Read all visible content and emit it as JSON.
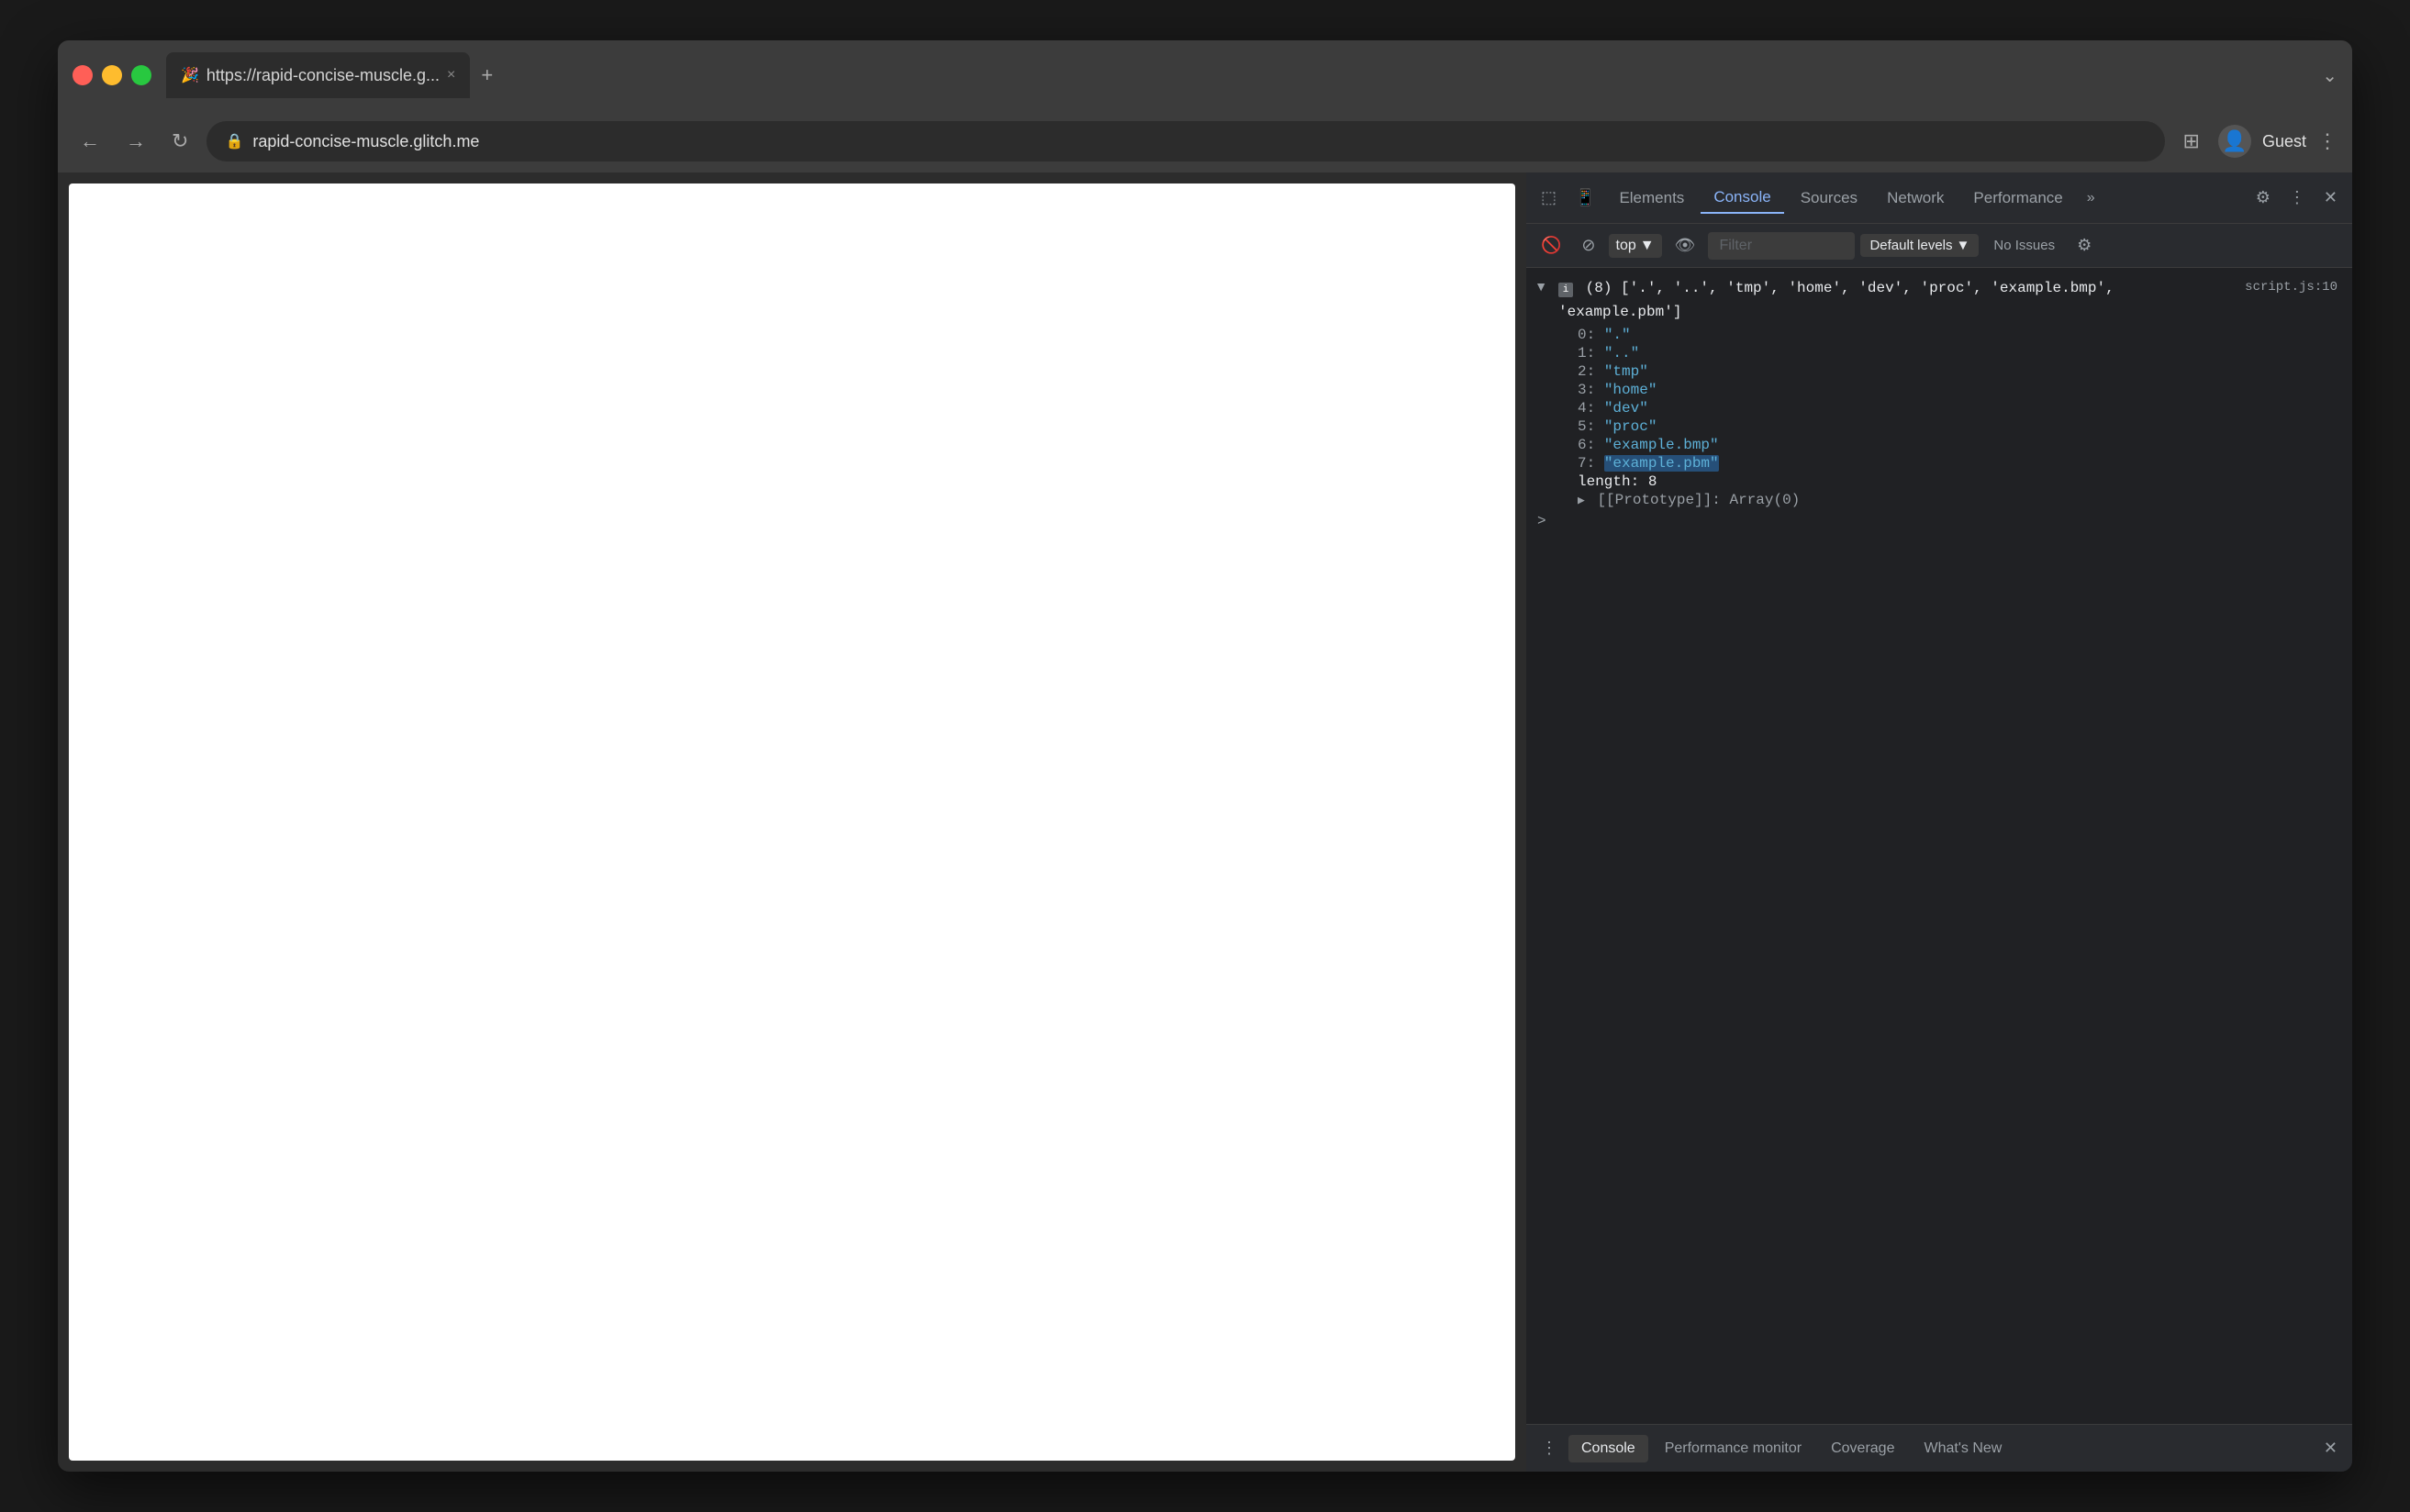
{
  "browser": {
    "tab_url": "https://rapid-concise-muscle.g...",
    "tab_close_label": "×",
    "tab_add_label": "+",
    "tab_favicon": "🎉",
    "address": "rapid-concise-muscle.glitch.me",
    "nav_back_label": "←",
    "nav_forward_label": "→",
    "nav_reload_label": "↻",
    "nav_user_label": "Guest",
    "nav_menu_label": "⋮",
    "nav_sidebar_label": "⊞",
    "nav_chevron_label": "⌄"
  },
  "devtools": {
    "tabs": [
      {
        "label": "Elements",
        "active": false
      },
      {
        "label": "Console",
        "active": true
      },
      {
        "label": "Sources",
        "active": false
      },
      {
        "label": "Network",
        "active": false
      },
      {
        "label": "Performance",
        "active": false
      }
    ],
    "tabs_more_label": "»",
    "settings_icon": "⚙",
    "close_icon": "✕",
    "menu_icon": "⋮",
    "secondary": {
      "inspect_icon": "⬚",
      "no_circle_icon": "⊘",
      "context_dropdown": "top",
      "context_dropdown_arrow": "▼",
      "eye_icon": "👁",
      "filter_placeholder": "Filter",
      "default_levels_label": "Default levels",
      "default_levels_arrow": "▼",
      "no_issues_label": "No Issues",
      "settings_icon": "⚙"
    },
    "console": {
      "source_link": "script.js:10",
      "array_preview": "(8) ['.', '..', 'tmp', 'home', 'dev', 'proc', 'example.bmp', 'example.pbm']",
      "items": [
        {
          "key": "0",
          "value": "\".\""
        },
        {
          "key": "1",
          "value": "\"..\""
        },
        {
          "key": "2",
          "value": "\"tmp\""
        },
        {
          "key": "3",
          "value": "\"home\""
        },
        {
          "key": "4",
          "value": "\"dev\""
        },
        {
          "key": "5",
          "value": "\"proc\""
        },
        {
          "key": "6",
          "value": "\"example.bmp\""
        },
        {
          "key": "7",
          "value": "\"example.pbm\"",
          "highlighted": true
        }
      ],
      "length_key": "length",
      "length_value": "8",
      "prototype_label": "[[Prototype]]",
      "prototype_value": "Array(0)"
    },
    "bottom_tabs": [
      {
        "label": "Console",
        "active": true
      },
      {
        "label": "Performance monitor",
        "active": false
      },
      {
        "label": "Coverage",
        "active": false
      },
      {
        "label": "What's New",
        "active": false
      }
    ],
    "bottom_menu_label": "⋮",
    "bottom_close_label": "✕"
  }
}
